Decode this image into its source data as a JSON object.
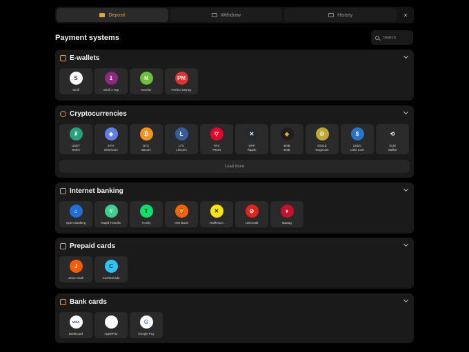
{
  "tabs": [
    {
      "label": "Deposit",
      "icon": "wallet-icon"
    },
    {
      "label": "Withdraw",
      "icon": "card-icon"
    },
    {
      "label": "History",
      "icon": "list-icon"
    }
  ],
  "close_label": "×",
  "page_title": "Payment systems",
  "search": {
    "placeholder": "Search"
  },
  "accent": "#e8a23b",
  "sections": {
    "ewallets": {
      "title": "E-wallets",
      "items": [
        {
          "l1": "Skrill",
          "l2": "",
          "glyph": "S",
          "color": "#7a1a6e",
          "bg": "#ffffff"
        },
        {
          "l1": "Skrill 1-Tap",
          "l2": "",
          "glyph": "1",
          "color": "#ffffff",
          "bg": "#8c2a7d"
        },
        {
          "l1": "Neteller",
          "l2": "",
          "glyph": "N",
          "color": "#ffffff",
          "bg": "#6fbf3a"
        },
        {
          "l1": "Perfect Money",
          "l2": "",
          "glyph": "PM",
          "color": "#ffffff",
          "bg": "#e0322e"
        }
      ]
    },
    "crypto": {
      "title": "Cryptocurrencies",
      "items": [
        {
          "l1": "USDT",
          "l2": "Tether",
          "glyph": "₮",
          "color": "#ffffff",
          "bg": "#26a17b"
        },
        {
          "l1": "ETH",
          "l2": "Ethereum",
          "glyph": "◆",
          "color": "#ffffff",
          "bg": "#627eea"
        },
        {
          "l1": "BTC",
          "l2": "Bitcoin",
          "glyph": "₿",
          "color": "#ffffff",
          "bg": "#f7931a"
        },
        {
          "l1": "LTC",
          "l2": "Litecoin",
          "glyph": "Ł",
          "color": "#ffffff",
          "bg": "#345d9d"
        },
        {
          "l1": "TRX",
          "l2": "TRON",
          "glyph": "▽",
          "color": "#ffffff",
          "bg": "#eb0029"
        },
        {
          "l1": "XRP",
          "l2": "Ripple",
          "glyph": "✕",
          "color": "#ffffff",
          "bg": "#23292f"
        },
        {
          "l1": "BNB",
          "l2": "BNB",
          "glyph": "◈",
          "color": "#f3ba2f",
          "bg": "#1e1e1e"
        },
        {
          "l1": "DOGE",
          "l2": "Dogecoin",
          "glyph": "Ð",
          "color": "#ffffff",
          "bg": "#c2a633"
        },
        {
          "l1": "USDC",
          "l2": "USD Coin",
          "glyph": "$",
          "color": "#ffffff",
          "bg": "#2775ca"
        },
        {
          "l1": "XLM",
          "l2": "Stellar",
          "glyph": "⟲",
          "color": "#ffffff",
          "bg": "#2b2b2b"
        }
      ],
      "load_more": "Load more"
    },
    "banking": {
      "title": "Internet banking",
      "items": [
        {
          "l1": "Open Banking",
          "l2": "",
          "glyph": "⌂",
          "color": "#ffffff",
          "bg": "#1f6fd6"
        },
        {
          "l1": "Rapid Transfer",
          "l2": "",
          "glyph": "//",
          "color": "#ffffff",
          "bg": "#3fcf8e"
        },
        {
          "l1": "Trustly",
          "l2": "",
          "glyph": "T",
          "color": "#0a0a0a",
          "bg": "#0ee06e"
        },
        {
          "l1": "ING Bank",
          "l2": "",
          "glyph": "🦁",
          "color": "#ffffff",
          "bg": "#ff6200"
        },
        {
          "l1": "Raiffeisen",
          "l2": "",
          "glyph": "✕",
          "color": "#1a1a1a",
          "bg": "#ffe600"
        },
        {
          "l1": "UniCredit",
          "l2": "",
          "glyph": "⊘",
          "color": "#ffffff",
          "bg": "#e2231a"
        },
        {
          "l1": "Bawag",
          "l2": "",
          "glyph": "♦",
          "color": "#ffffff",
          "bg": "#c8102e"
        }
      ]
    },
    "prepaid": {
      "title": "Prepaid cards",
      "items": [
        {
          "l1": "Jeton Cash",
          "l2": "",
          "glyph": "J",
          "color": "#ffffff",
          "bg": "#ff5a00"
        },
        {
          "l1": "CashtoCode",
          "l2": "",
          "glyph": "C",
          "color": "#0d2a3a",
          "bg": "#2fc3f0"
        }
      ]
    },
    "bankcards": {
      "title": "Bank cards",
      "items": [
        {
          "l1": "BankCard",
          "l2": "",
          "glyph": "VISA",
          "color": "#1a1f71",
          "bg": "#ffffff"
        },
        {
          "l1": "ApplePay",
          "l2": "",
          "glyph": "",
          "color": "#111111",
          "bg": "#ffffff"
        },
        {
          "l1": "Google Pay",
          "l2": "",
          "glyph": "G",
          "color": "#4285f4",
          "bg": "#ffffff"
        }
      ]
    }
  }
}
